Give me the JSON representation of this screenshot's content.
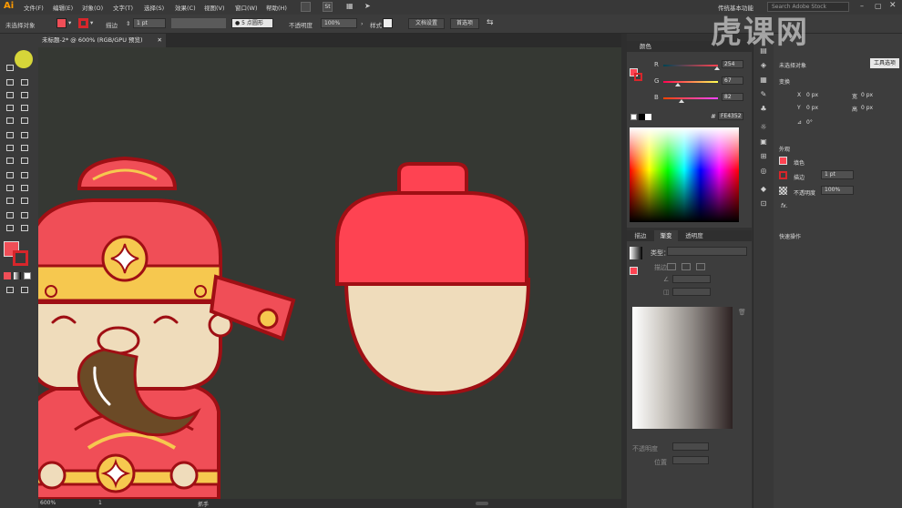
{
  "app": {
    "logo": "Ai"
  },
  "menu": [
    "文件(F)",
    "编辑(E)",
    "对象(O)",
    "文字(T)",
    "选择(S)",
    "效果(C)",
    "视图(V)",
    "窗口(W)",
    "帮助(H)"
  ],
  "workspace": {
    "label": "传统基本功能",
    "search_placeholder": "Search Adobe Stock"
  },
  "options_bar": {
    "selection_label": "未选择对象",
    "fill_color": "#f04e57",
    "stroke_color": "#d7262b",
    "stroke_label": "描边",
    "stroke_width": "1 pt",
    "brush_label": "5 点圆形",
    "opacity_label": "不透明度",
    "opacity_value": "100%",
    "style_label": "样式",
    "doc_setup_button": "文档设置",
    "prefs_button": "首选项"
  },
  "document": {
    "tab_title": "未标题-2* @ 600% (RGB/GPU 预览)",
    "zoom": "600%",
    "page": "1",
    "status_tool": "抓手"
  },
  "color_panel": {
    "title": "颜色",
    "r_label": "R",
    "r_value": "254",
    "g_label": "G",
    "g_value": "67",
    "b_label": "B",
    "b_value": "82",
    "hex": "FE4352"
  },
  "gradient_panel": {
    "tabs": [
      "描边",
      "渐变",
      "透明度"
    ],
    "type_label": "类型：",
    "stroke_label": "描边",
    "opacity_label": "不透明度",
    "location_label": "位置"
  },
  "properties": {
    "header": "未选择对象",
    "doc_button": "工具选项",
    "transform_title": "变换",
    "x_label": "X",
    "y_label": "Y",
    "w_label": "宽",
    "h_label": "高",
    "x_value": "0 px",
    "y_value": "0 px",
    "w_value": "0 px",
    "h_value": "0 px",
    "angle_value": "0°",
    "appearance_title": "外观",
    "fill_label": "填色",
    "stroke_label": "描边",
    "stroke_value": "1 pt",
    "opacity_label": "不透明度",
    "opacity_value": "100%",
    "fx_label": "fx.",
    "quick_actions_title": "快速操作"
  },
  "watermark": "虎课网",
  "colors": {
    "accent_red": "#fe4352",
    "dark_red": "#9f0f14",
    "skin": "#efdcbb",
    "gold": "#f6c84f",
    "beard": "#6b4a26"
  }
}
